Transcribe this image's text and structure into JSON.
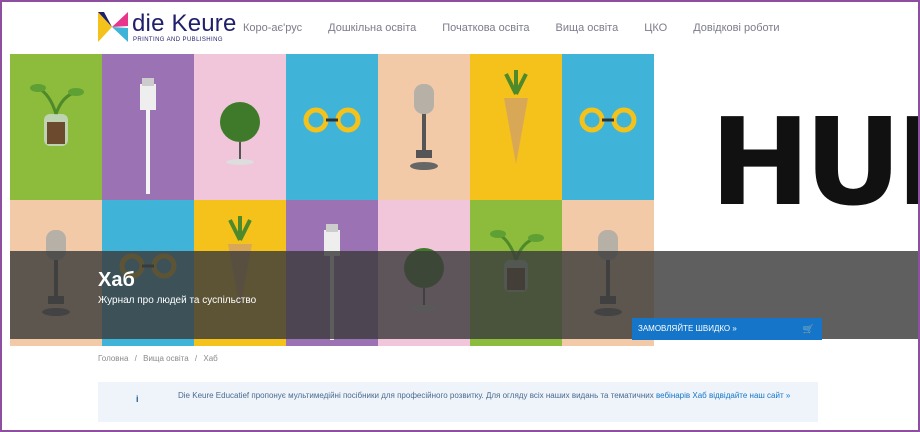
{
  "header": {
    "brand_name": "die Keure",
    "brand_tagline": "PRINTING AND PUBLISHING",
    "nav": [
      "Коро-ає'рус",
      "Дошкільна освіта",
      "Початкова освіта",
      "Вища освіта",
      "ЦКО",
      "Довідкові роботи"
    ]
  },
  "hero": {
    "logo_text": "HUB",
    "title": "Хаб",
    "subtitle": "Журнал про людей та суспільство",
    "order_button": "ЗАМОВЛЯЙТЕ ШВИДКО »",
    "tiles": [
      {
        "bg": "#8dbb3b",
        "icon": "plant-jar-icon"
      },
      {
        "bg": "#9b72b4",
        "icon": "usb-cable-icon"
      },
      {
        "bg": "#f1c6da",
        "icon": "topiary-tree-icon"
      },
      {
        "bg": "#3fb4d8",
        "icon": "yellow-glasses-icon"
      },
      {
        "bg": "#f2caa8",
        "icon": "microphone-icon"
      },
      {
        "bg": "#f4c21b",
        "icon": "pineapple-cone-icon"
      },
      {
        "bg": "#3fb4d8",
        "icon": "yellow-glasses-icon"
      },
      {
        "bg": "#f2caa8",
        "icon": "microphone-icon"
      },
      {
        "bg": "#3fb4d8",
        "icon": "yellow-glasses-icon"
      },
      {
        "bg": "#f4c21b",
        "icon": "pineapple-cone-icon"
      },
      {
        "bg": "#9b72b4",
        "icon": "usb-cable-icon"
      },
      {
        "bg": "#f1c6da",
        "icon": "topiary-tree-icon"
      },
      {
        "bg": "#8dbb3b",
        "icon": "plant-jar-icon"
      },
      {
        "bg": "#f2caa8",
        "icon": "microphone-icon"
      }
    ]
  },
  "breadcrumb": [
    "Головна",
    "/",
    "Вища освіта",
    "/",
    "Хаб"
  ],
  "notice": {
    "icon": "i",
    "text": "Die Keure Educatief пропонує мультимедійні посібники для професійного розвитку. Для огляду всіх наших видань та тематичних",
    "link_text": "вебінарів Хаб відвідайте наш сайт »"
  },
  "colors": {
    "frame": "#8e4fa0",
    "button": "#1576c9",
    "banner": "#3c3c3c"
  }
}
